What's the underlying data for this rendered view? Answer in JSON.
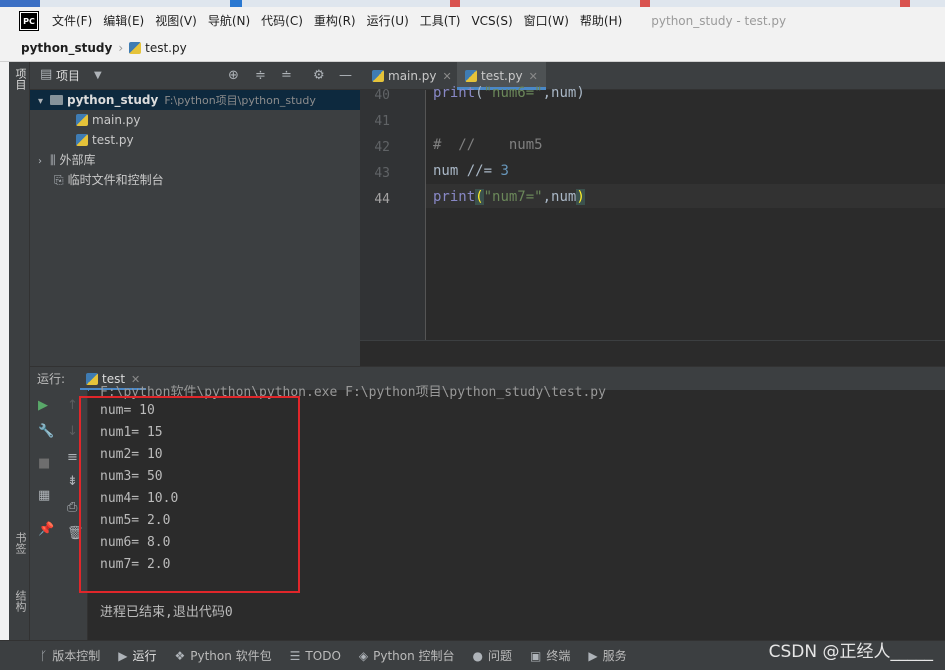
{
  "menubar": {
    "items": [
      "文件(F)",
      "编辑(E)",
      "视图(V)",
      "导航(N)",
      "代码(C)",
      "重构(R)",
      "运行(U)",
      "工具(T)",
      "VCS(S)",
      "窗口(W)",
      "帮助(H)"
    ],
    "window_title": "python_study - test.py",
    "logo_text": "PC"
  },
  "breadcrumb": {
    "project": "python_study",
    "file": "test.py"
  },
  "left_stripe": {
    "project_label": "项目",
    "bookmarks_label": "书签",
    "structure_label": "结构"
  },
  "project_panel": {
    "title": "项目",
    "root": {
      "name": "python_study",
      "path": "F:\\python项目\\python_study"
    },
    "files": [
      "main.py",
      "test.py"
    ],
    "external_libs": "外部库",
    "scratches": "临时文件和控制台"
  },
  "editor": {
    "tabs": [
      {
        "label": "main.py",
        "active": false
      },
      {
        "label": "test.py",
        "active": true
      }
    ],
    "line_numbers": [
      "40",
      "41",
      "42",
      "43",
      "44"
    ],
    "current_line": "44"
  },
  "run": {
    "label": "运行:",
    "tab": "test",
    "command_partial": "F:\\python软件\\python\\python.exe F:\\python项目\\python_study\\test.py",
    "output": [
      "num= 10",
      "num1= 15",
      "num2= 10",
      "num3= 50",
      "num4= 10.0",
      "num5= 2.0",
      "num6= 8.0",
      "num7= 2.0"
    ],
    "exit_message": "进程已结束,退出代码0"
  },
  "bottom_bar": [
    "版本控制",
    "运行",
    "Python 软件包",
    "TODO",
    "Python 控制台",
    "问题",
    "终端",
    "服务"
  ],
  "watermark": "CSDN @正经人_____",
  "colors": {
    "highlight_box": "#e0262a",
    "accent": "#4a88c7",
    "string": "#6a8759",
    "number": "#6897bb"
  }
}
